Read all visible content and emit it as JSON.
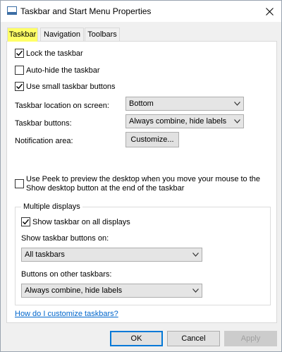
{
  "window": {
    "title": "Taskbar and Start Menu Properties"
  },
  "tabs": [
    {
      "label": "Taskbar",
      "active": true
    },
    {
      "label": "Navigation",
      "active": false
    },
    {
      "label": "Toolbars",
      "active": false
    }
  ],
  "taskbar": {
    "lock_label": "Lock the taskbar",
    "lock_checked": true,
    "autohide_label": "Auto-hide the taskbar",
    "autohide_checked": false,
    "small_buttons_label": "Use small taskbar buttons",
    "small_buttons_checked": true,
    "location_label": "Taskbar location on screen:",
    "location_value": "Bottom",
    "buttons_label": "Taskbar buttons:",
    "buttons_value": "Always combine, hide labels",
    "notification_label": "Notification area:",
    "customize_label": "Customize...",
    "peek_label_line1": "Use Peek to preview the desktop when you move your mouse to the",
    "peek_label_line2": "Show desktop button at the end of the taskbar",
    "peek_checked": false
  },
  "multiple_displays": {
    "legend": "Multiple displays",
    "show_all_label": "Show taskbar on all displays",
    "show_all_checked": true,
    "show_buttons_on_label": "Show taskbar buttons on:",
    "show_buttons_on_value": "All taskbars",
    "other_taskbars_label": "Buttons on other taskbars:",
    "other_taskbars_value": "Always combine, hide labels"
  },
  "help_link": "How do I customize taskbars?",
  "footer": {
    "ok_label": "OK",
    "cancel_label": "Cancel",
    "apply_label": "Apply"
  },
  "colors": {
    "active_tab_highlight": "#ffff66",
    "link": "#0066cc",
    "default_button_border": "#0078d7"
  }
}
